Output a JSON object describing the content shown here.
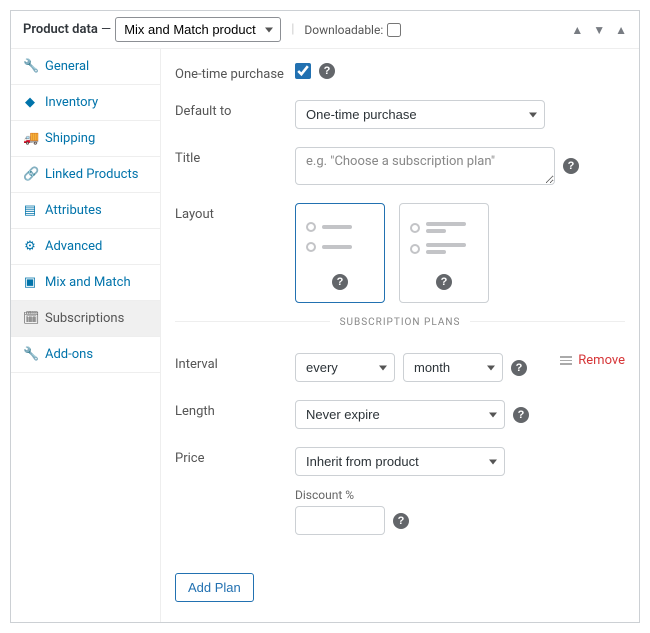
{
  "header": {
    "title": "Product data",
    "dash": " — ",
    "product_type": "Mix and Match product",
    "sep": "|",
    "downloadable_label": "Downloadable:"
  },
  "tabs": [
    {
      "icon": "🔧",
      "label": "General"
    },
    {
      "icon": "◆",
      "label": "Inventory"
    },
    {
      "icon": "🚚",
      "label": "Shipping"
    },
    {
      "icon": "🔗",
      "label": "Linked Products"
    },
    {
      "icon": "▤",
      "label": "Attributes"
    },
    {
      "icon": "⚙",
      "label": "Advanced"
    },
    {
      "icon": "▣",
      "label": "Mix and Match"
    },
    {
      "icon": "🗓",
      "label": "Subscriptions",
      "active": true
    },
    {
      "icon": "🔧",
      "label": "Add-ons"
    }
  ],
  "fields": {
    "one_time_label": "One-time purchase",
    "default_to_label": "Default to",
    "default_to_value": "One-time purchase",
    "title_label": "Title",
    "title_placeholder": "e.g. \"Choose a subscription plan\"",
    "layout_label": "Layout"
  },
  "section_title": "SUBSCRIPTION PLANS",
  "plan": {
    "remove_label": "Remove",
    "interval_label": "Interval",
    "interval_freq": "every",
    "interval_period": "month",
    "length_label": "Length",
    "length_value": "Never expire",
    "price_label": "Price",
    "price_value": "Inherit from product",
    "discount_label": "Discount %"
  },
  "add_plan_label": "Add Plan"
}
